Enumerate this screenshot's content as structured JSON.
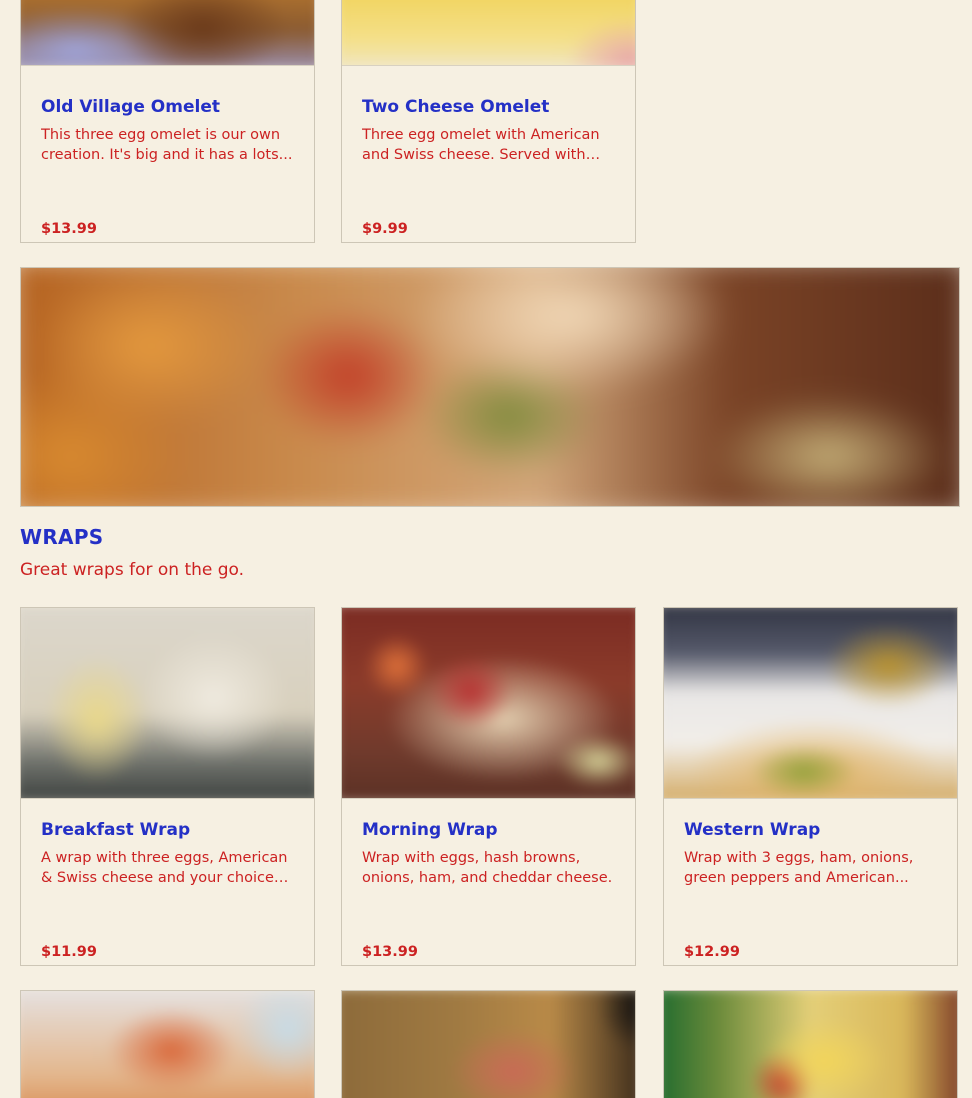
{
  "omelets": {
    "items": [
      {
        "name": "Old Village Omelet",
        "description": "This three egg omelet is our own creation. It's big and it has a lots...",
        "price": "$13.99"
      },
      {
        "name": "Two Cheese Omelet",
        "description": "Three egg omelet with American and Swiss cheese. Served with toa...",
        "price": "$9.99"
      }
    ]
  },
  "wraps": {
    "title": "WRAPS",
    "subtitle": "Great wraps for on the go.",
    "items": [
      {
        "name": "Breakfast Wrap",
        "description": "A wrap with three eggs, American & Swiss cheese and your choice o...",
        "price": "$11.99"
      },
      {
        "name": "Morning Wrap",
        "description": "Wrap with eggs, hash browns, onions, ham, and cheddar cheese.",
        "price": "$13.99"
      },
      {
        "name": "Western Wrap",
        "description": "Wrap with 3 eggs, ham, onions, green peppers and American...",
        "price": "$12.99"
      }
    ]
  }
}
